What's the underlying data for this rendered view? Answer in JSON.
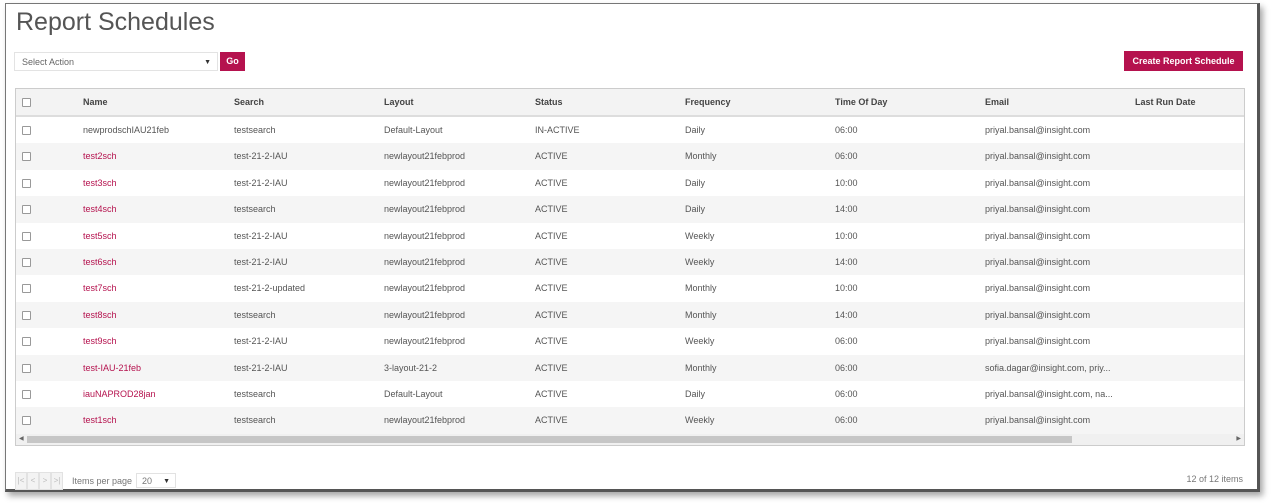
{
  "title": "Report Schedules",
  "toolbar": {
    "select_placeholder": "Select Action",
    "go_label": "Go",
    "create_label": "Create Report Schedule"
  },
  "colors": {
    "accent": "#b5124e"
  },
  "table": {
    "headers": [
      "Name",
      "Search",
      "Layout",
      "Status",
      "Frequency",
      "Time Of Day",
      "Email",
      "Last Run Date"
    ],
    "rows": [
      [
        "newprodschIAU21feb",
        "testsearch",
        "Default-Layout",
        "IN-ACTIVE",
        "Daily",
        "06:00",
        "priyal.bansal@insight.com",
        ""
      ],
      [
        "test2sch",
        "test-21-2-IAU",
        "newlayout21febprod",
        "ACTIVE",
        "Monthly",
        "06:00",
        "priyal.bansal@insight.com",
        ""
      ],
      [
        "test3sch",
        "test-21-2-IAU",
        "newlayout21febprod",
        "ACTIVE",
        "Daily",
        "10:00",
        "priyal.bansal@insight.com",
        ""
      ],
      [
        "test4sch",
        "testsearch",
        "newlayout21febprod",
        "ACTIVE",
        "Daily",
        "14:00",
        "priyal.bansal@insight.com",
        ""
      ],
      [
        "test5sch",
        "test-21-2-IAU",
        "newlayout21febprod",
        "ACTIVE",
        "Weekly",
        "10:00",
        "priyal.bansal@insight.com",
        ""
      ],
      [
        "test6sch",
        "test-21-2-IAU",
        "newlayout21febprod",
        "ACTIVE",
        "Weekly",
        "14:00",
        "priyal.bansal@insight.com",
        ""
      ],
      [
        "test7sch",
        "test-21-2-updated",
        "newlayout21febprod",
        "ACTIVE",
        "Monthly",
        "10:00",
        "priyal.bansal@insight.com",
        ""
      ],
      [
        "test8sch",
        "testsearch",
        "newlayout21febprod",
        "ACTIVE",
        "Monthly",
        "14:00",
        "priyal.bansal@insight.com",
        ""
      ],
      [
        "test9sch",
        "test-21-2-IAU",
        "newlayout21febprod",
        "ACTIVE",
        "Weekly",
        "06:00",
        "priyal.bansal@insight.com",
        ""
      ],
      [
        "test-IAU-21feb",
        "test-21-2-IAU",
        "3-layout-21-2",
        "ACTIVE",
        "Monthly",
        "06:00",
        "sofia.dagar@insight.com, priy...",
        ""
      ],
      [
        "iauNAPROD28jan",
        "testsearch",
        "Default-Layout",
        "ACTIVE",
        "Daily",
        "06:00",
        "priyal.bansal@insight.com, na...",
        ""
      ],
      [
        "test1sch",
        "testsearch",
        "newlayout21febprod",
        "ACTIVE",
        "Weekly",
        "06:00",
        "priyal.bansal@insight.com",
        ""
      ]
    ],
    "linked_names": [
      false,
      true,
      true,
      true,
      true,
      true,
      true,
      true,
      true,
      true,
      true,
      true
    ]
  },
  "pager": {
    "first": "|<",
    "prev": "<",
    "next": ">",
    "last": ">|",
    "items_per_page_label": "Items per page",
    "items_per_page": "20",
    "count_label": "12 of 12 items"
  }
}
